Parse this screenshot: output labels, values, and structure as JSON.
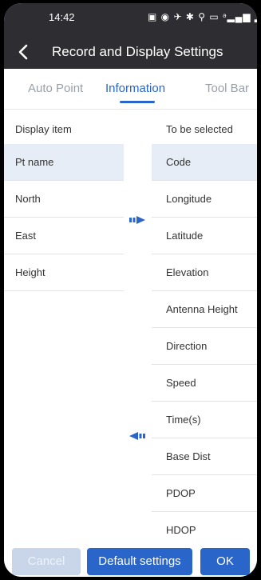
{
  "status": {
    "time": "14:42",
    "icons_text": "▣ ◉ ✈ ✱ ⚲ ▭ ᵊ▂▄▆ ▂▄▆ ▭",
    "icons": [
      "notification-icon",
      "alarm-icon",
      "bluetooth-icon",
      "location-icon",
      "card-icon",
      "wifi-icon",
      "signal-icon",
      "signal-icon",
      "battery-icon"
    ]
  },
  "header": {
    "title": "Record and Display Settings"
  },
  "tabs": [
    {
      "label": "Auto Point",
      "active": false
    },
    {
      "label": "Information",
      "active": true
    },
    {
      "label": "Tool Bar",
      "active": false
    }
  ],
  "left_column": {
    "header": "Display item",
    "items": [
      "Pt name",
      "North",
      "East",
      "Height"
    ],
    "selected": "Pt name"
  },
  "right_column": {
    "header": "To be selected",
    "items": [
      "Code",
      "Longitude",
      "Latitude",
      "Elevation",
      "Antenna Height",
      "Direction",
      "Speed",
      "Time(s)",
      "Base Dist",
      "PDOP",
      "HDOP"
    ],
    "selected": "Code"
  },
  "arrows": {
    "move_right": "arrow-right-icon",
    "move_left": "arrow-left-icon"
  },
  "footer": {
    "cancel_label": "Cancel",
    "default_label": "Default settings",
    "ok_label": "OK"
  },
  "colors": {
    "accent": "#2a66c9",
    "header_bg": "#2e2e32",
    "selected_row": "#e6edf6",
    "disabled_button": "#c9d6ea"
  }
}
